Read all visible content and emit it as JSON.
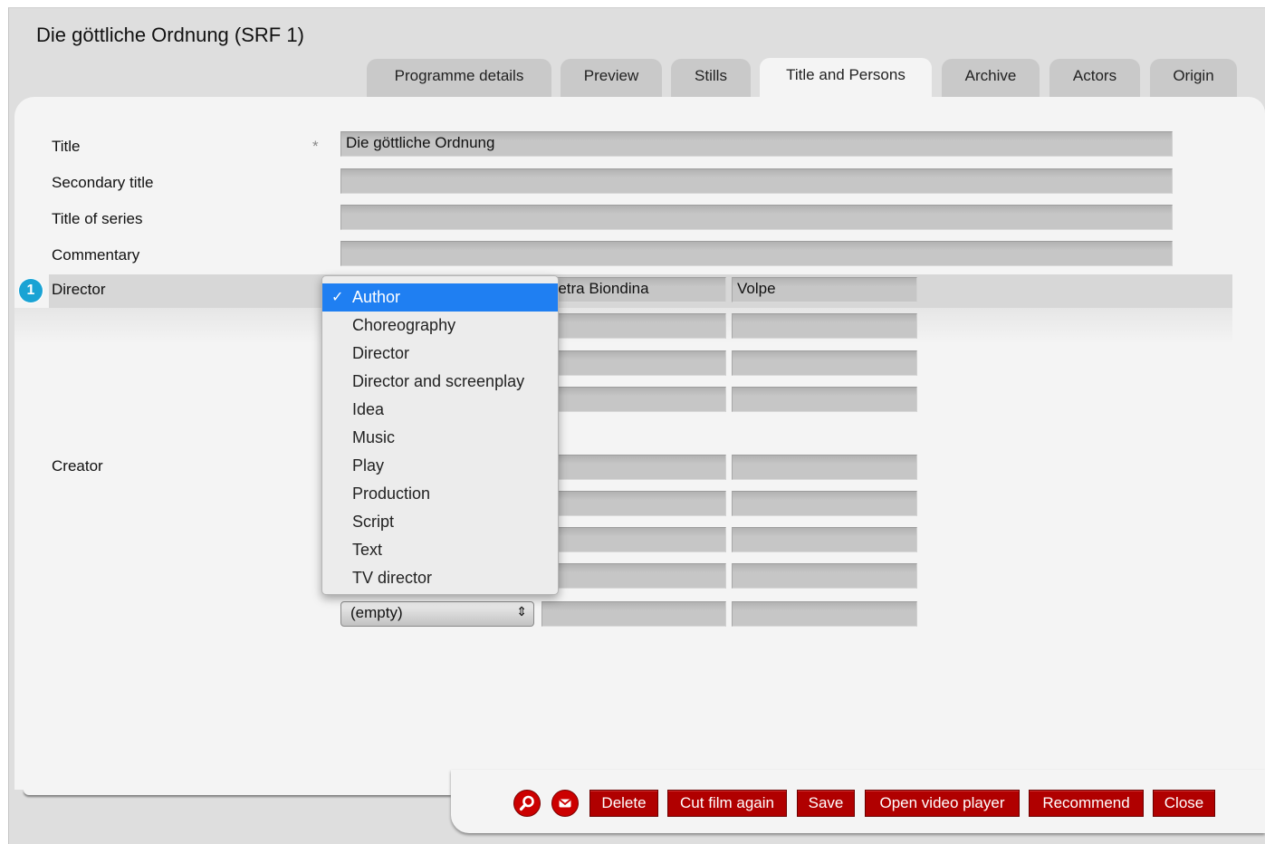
{
  "window": {
    "title": "Die göttliche Ordnung (SRF 1)"
  },
  "tabs": [
    {
      "label": "Programme details",
      "active": false
    },
    {
      "label": "Preview",
      "active": false
    },
    {
      "label": "Stills",
      "active": false
    },
    {
      "label": "Title and Persons",
      "active": true
    },
    {
      "label": "Archive",
      "active": false
    },
    {
      "label": "Actors",
      "active": false
    },
    {
      "label": "Origin",
      "active": false
    }
  ],
  "form": {
    "title_label": "Title",
    "required_marker": "*",
    "title_value": "Die göttliche Ordnung",
    "secondary_title_label": "Secondary title",
    "secondary_title_value": "",
    "series_label": "Title of series",
    "series_value": "",
    "commentary_label": "Commentary",
    "commentary_value": "",
    "director_label": "Director",
    "director_badge": "1",
    "director_firstname": "Petra Biondina",
    "director_lastname": "Volpe",
    "creator_label": "Creator",
    "creator_select_value": "(empty)"
  },
  "dropdown": {
    "check_mark": "✓",
    "options": [
      "Author",
      "Choreography",
      "Director",
      "Director and screenplay",
      "Idea",
      "Music",
      "Play",
      "Production",
      "Script",
      "Text",
      "TV director"
    ],
    "selected": "Author"
  },
  "footer": {
    "icons": [
      "search-icon",
      "mail-icon"
    ],
    "buttons": [
      "Delete",
      "Cut film again",
      "Save",
      "Open video player",
      "Recommend",
      "Close"
    ]
  },
  "colors": {
    "button_red": "#b00000",
    "badge_blue": "#1aa3d4",
    "selection_blue": "#1f7ff2"
  }
}
